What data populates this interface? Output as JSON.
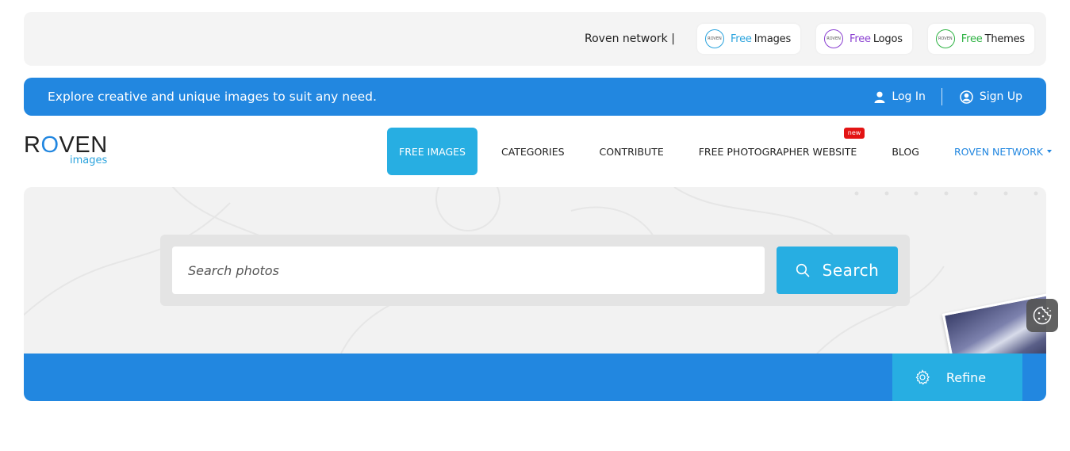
{
  "network_bar": {
    "label": "Roven network |",
    "sites": [
      {
        "free": "Free",
        "name": "Images",
        "free_color": "#2aa3dd",
        "ring_color": "#2aa3dd",
        "logo_text": "ROVEN"
      },
      {
        "free": "Free",
        "name": "Logos",
        "free_color": "#8a3fd1",
        "ring_color": "#8a3fd1",
        "logo_text": "ROVEN"
      },
      {
        "free": "Free",
        "name": "Themes",
        "free_color": "#2fb344",
        "ring_color": "#2fb344",
        "logo_text": "ROVEN"
      }
    ]
  },
  "top_strip": {
    "tagline": "Explore creative and unique images to suit any need.",
    "login_label": "Log In",
    "signup_label": "Sign Up"
  },
  "brand": {
    "name_pre": "R",
    "name_o": "O",
    "name_post": "VEN",
    "sub": "images"
  },
  "nav": {
    "items": [
      {
        "label": "FREE IMAGES",
        "active": true
      },
      {
        "label": "CATEGORIES"
      },
      {
        "label": "CONTRIBUTE"
      },
      {
        "label": "FREE PHOTOGRAPHER WEBSITE",
        "badge": "new"
      },
      {
        "label": "BLOG"
      },
      {
        "label": "ROVEN NETWORK",
        "accent": true
      }
    ]
  },
  "search": {
    "placeholder": "Search photos",
    "button_label": "Search"
  },
  "refine": {
    "label": "Refine"
  },
  "colors": {
    "primary_blue": "#2287e0",
    "accent_cyan": "#27aee2",
    "badge_red": "#e31414"
  },
  "icons": {
    "login": "user-icon",
    "signup": "user-circle-icon",
    "search": "search-icon",
    "refine": "gear-icon",
    "cookie": "cookie-icon"
  }
}
